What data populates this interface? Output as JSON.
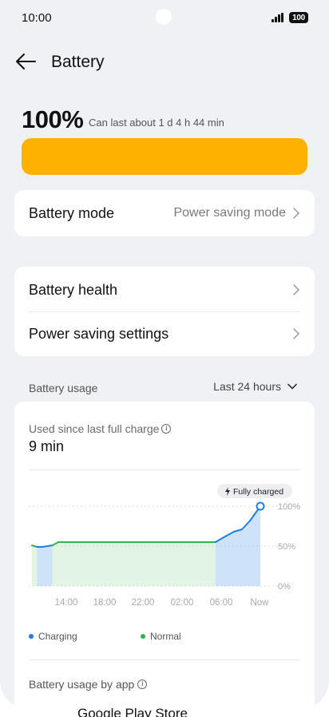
{
  "status_bar": {
    "time": "10:00",
    "battery_level": "100"
  },
  "header": {
    "title": "Battery"
  },
  "battery": {
    "percent": "100%",
    "estimate": "Can last about 1 d 4 h 44 min",
    "level_fraction": 1.0,
    "bar_color": "#ffb100"
  },
  "mode_card": {
    "label": "Battery mode",
    "value": "Power saving mode"
  },
  "settings_card": {
    "health_label": "Battery health",
    "power_saving_label": "Power saving settings"
  },
  "usage": {
    "section_title": "Battery usage",
    "range": "Last 24 hours",
    "used_label": "Used since last full charge",
    "used_value": "9 min",
    "badge": "Fully charged",
    "by_app_label": "Battery usage by app"
  },
  "chart_data": {
    "type": "area",
    "x_ticks": [
      "14:00",
      "18:00",
      "22:00",
      "02:00",
      "06:00",
      "Now"
    ],
    "y_ticks": [
      "100%",
      "50%",
      "0%"
    ],
    "ylim": [
      0,
      100
    ],
    "series": [
      {
        "name": "Charging",
        "color": "#1e7ee6"
      },
      {
        "name": "Normal",
        "color": "#2fb54a"
      }
    ],
    "points": [
      {
        "h": 0.0,
        "v": 51,
        "s": "Normal"
      },
      {
        "h": 0.5,
        "v": 49,
        "s": "Normal"
      },
      {
        "h": 1.0,
        "v": 49,
        "s": "Charging"
      },
      {
        "h": 2.0,
        "v": 51,
        "s": "Charging"
      },
      {
        "h": 2.6,
        "v": 55,
        "s": "Normal"
      },
      {
        "h": 18.0,
        "v": 55,
        "s": "Normal"
      },
      {
        "h": 18.8,
        "v": 61,
        "s": "Charging"
      },
      {
        "h": 19.8,
        "v": 68,
        "s": "Charging"
      },
      {
        "h": 20.6,
        "v": 71,
        "s": "Charging"
      },
      {
        "h": 21.4,
        "v": 82,
        "s": "Charging"
      },
      {
        "h": 22.4,
        "v": 100,
        "s": "Charging"
      }
    ]
  },
  "bottom_peek": "Google Play Store"
}
